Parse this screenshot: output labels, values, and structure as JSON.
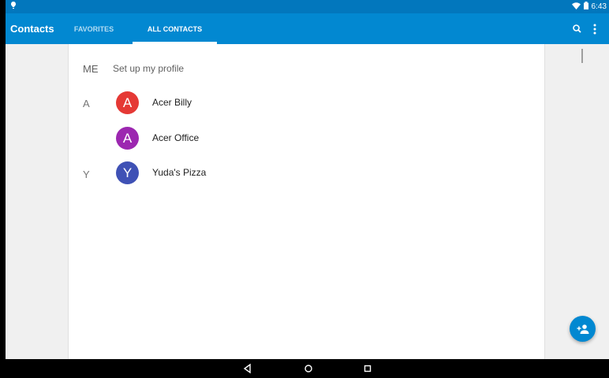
{
  "status": {
    "time": "6:43"
  },
  "appbar": {
    "title": "Contacts"
  },
  "tabs": [
    {
      "label": "FAVORITES",
      "selected": false
    },
    {
      "label": "ALL CONTACTS",
      "selected": true
    }
  ],
  "profile": {
    "label": "ME",
    "text": "Set up my profile"
  },
  "contacts": [
    {
      "section": "A",
      "initial": "A",
      "name": "Acer Billy",
      "color": "#e53935"
    },
    {
      "section": "",
      "initial": "A",
      "name": "Acer Office",
      "color": "#9c27b0"
    },
    {
      "section": "Y",
      "initial": "Y",
      "name": "Yuda's Pizza",
      "color": "#3f51b5"
    }
  ],
  "colors": {
    "appbar": "#0288d1",
    "statusbar": "#0277bd",
    "fab": "#0288d1"
  },
  "icons": {
    "search": "search-icon",
    "overflow": "more-vert-icon",
    "fab": "add-person-icon"
  }
}
